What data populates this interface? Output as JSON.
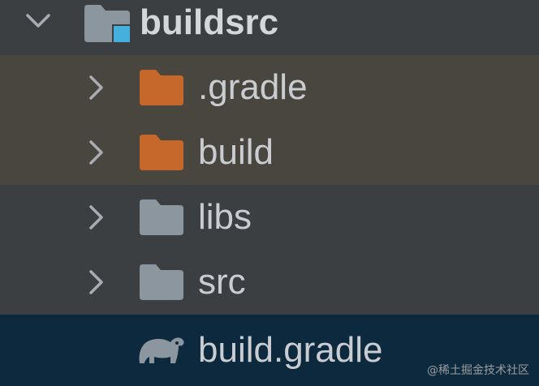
{
  "colors": {
    "background": "#3c3f41",
    "excluded_row": "#48463e",
    "selected_row": "#0d293e",
    "excluded_folder": "#c6682c",
    "plain_folder": "#8c969e",
    "module_badge": "#45b0dc",
    "text": "#c9cdd2"
  },
  "tree": {
    "root": {
      "label": "buildsrc",
      "expanded": true,
      "icon": "module-folder-icon"
    },
    "children": [
      {
        "label": ".gradle",
        "icon": "excluded-folder-icon",
        "state": "excluded"
      },
      {
        "label": "build",
        "icon": "excluded-folder-icon",
        "state": "excluded"
      },
      {
        "label": "libs",
        "icon": "folder-icon",
        "state": "normal"
      },
      {
        "label": "src",
        "icon": "folder-icon",
        "state": "normal"
      },
      {
        "label": "build.gradle",
        "icon": "gradle-elephant-icon",
        "state": "selected"
      }
    ]
  },
  "watermark": "@稀土掘金技术社区"
}
